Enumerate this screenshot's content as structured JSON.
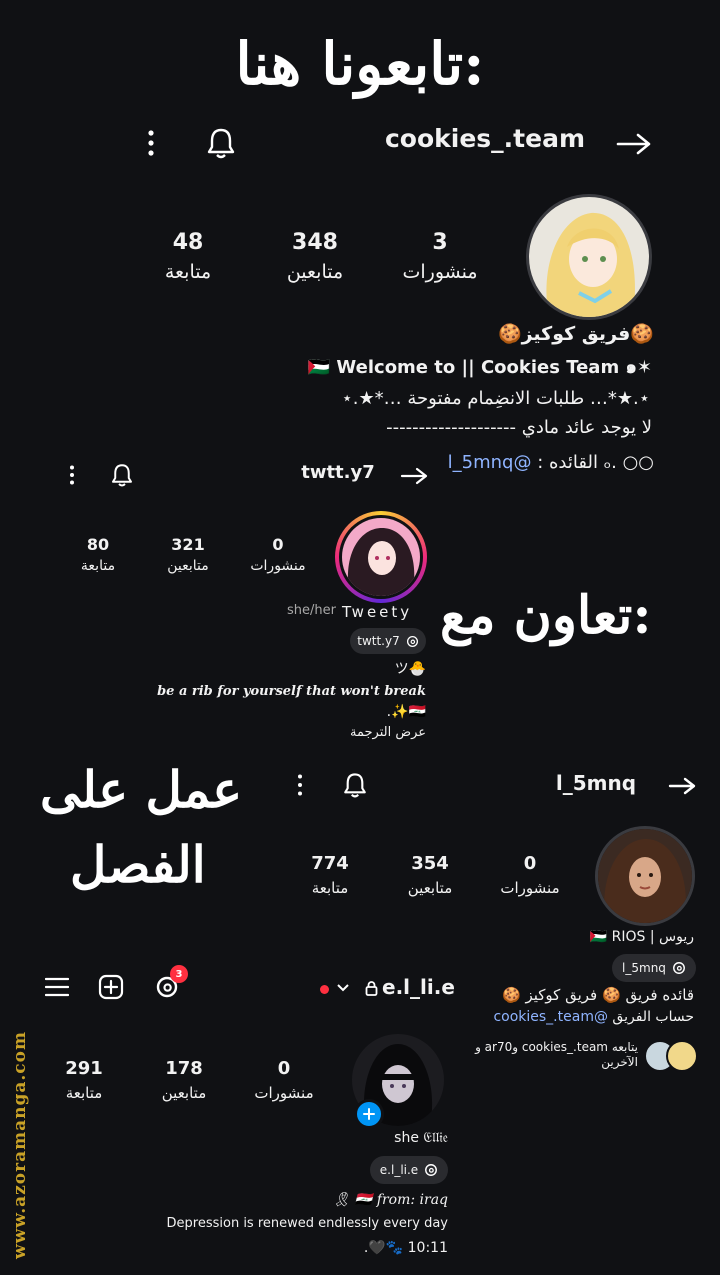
{
  "overlay": {
    "title_top": "تابعونا هنا:",
    "collab": "تعاون مع:",
    "work_line1": "عمل على",
    "work_line2": "الفصل"
  },
  "profile1": {
    "username": "cookies_.team",
    "stats": [
      {
        "number": "3",
        "label": "منشورات"
      },
      {
        "number": "348",
        "label": "متابعين"
      },
      {
        "number": "48",
        "label": "متابعة"
      }
    ],
    "name": "🍪فريق كوكيز🍪",
    "bio_line1": "✶🇵🇸 Welcome to || Cookies Team ๑",
    "bio_line2": "⋆.★*…   طلبات الانضِمام مفتوحة   …*★.⋆",
    "bio_line3": "لا يوجد عائد مادي --------------------",
    "bio_line4_text": "○○ .ₒ القائده : ",
    "bio_line4_link": "@l_5mnq"
  },
  "profile2": {
    "username": "twtt.y7",
    "stats": [
      {
        "number": "0",
        "label": "منشورات"
      },
      {
        "number": "321",
        "label": "متابعين"
      },
      {
        "number": "80",
        "label": "متابعة"
      }
    ],
    "display_name": "Tweety",
    "pronouns": "she/her",
    "threads_handle": "twtt.y7",
    "bio_line1": "🐣ツ",
    "bio_line2": "be a rib for yourself that won't break",
    "bio_line3": "🇮🇶✨.",
    "translate": "عرض الترجمة"
  },
  "profile3": {
    "username": "l_5mnq",
    "stats": [
      {
        "number": "0",
        "label": "منشورات"
      },
      {
        "number": "354",
        "label": "متابعين"
      },
      {
        "number": "774",
        "label": "متابعة"
      }
    ],
    "name": "ريوس | 🇵🇸 RIOS",
    "threads_handle": "l_5mnq",
    "bio_line1": "قائده فريق 🍪 فريق كوكيز 🍪",
    "bio_line2_text": "حساب الفريق ",
    "bio_line2_link": "@cookies_.team",
    "followed_by": "يتابعه cookies_.team وar70 و الآخرين"
  },
  "profile4": {
    "username": "e.l_li.e",
    "threads_badge": "3",
    "stats": [
      {
        "number": "0",
        "label": "منشورات"
      },
      {
        "number": "178",
        "label": "متابعين"
      },
      {
        "number": "291",
        "label": "متابعة"
      }
    ],
    "name": "she 𝔈𝔩𝔩𝔦𝔢",
    "threads_handle": "e.l_li.e",
    "bio_line1": "🇮🇶 from: iraq 🎗",
    "bio_line2": "Depression is renewed endlessly every day",
    "bio_line3": "10:11 🐾🖤."
  },
  "watermark": "www.azoramanga.com",
  "colors": {
    "background": "#101114",
    "link": "#8fb4ff",
    "badge": "#ff3040",
    "live_dot": "#ff3040",
    "pill": "#2a2b2f",
    "watermark": "#c9a227"
  }
}
